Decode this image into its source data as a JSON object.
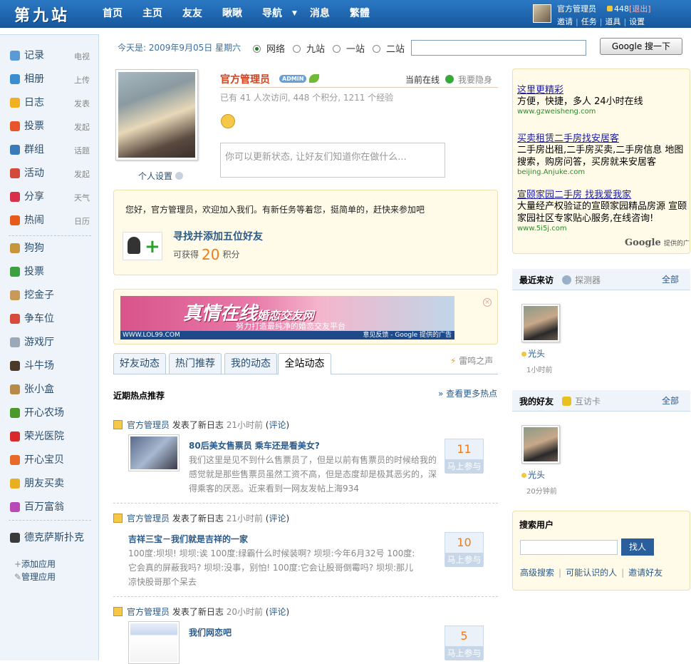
{
  "header": {
    "logo": "第九站",
    "nav": [
      "首页",
      "主页",
      "友友",
      "瞅瞅",
      "导航",
      "消息",
      "繁體"
    ],
    "user_name": "官方管理员",
    "coins": "448",
    "logout": "[退出]",
    "links": [
      "邀请",
      "任务",
      "道具",
      "设置"
    ]
  },
  "sidebar": {
    "primary": [
      {
        "label": "记录",
        "sub": "电视",
        "icon": "chat-icon",
        "color": "#5b9bd5"
      },
      {
        "label": "相册",
        "sub": "上传",
        "icon": "photo-icon",
        "color": "#3a8ed0"
      },
      {
        "label": "日志",
        "sub": "发表",
        "icon": "blog-icon",
        "color": "#f0b020"
      },
      {
        "label": "投票",
        "sub": "发起",
        "icon": "poll-icon",
        "color": "#e8552a"
      },
      {
        "label": "群组",
        "sub": "话题",
        "icon": "group-icon",
        "color": "#3a7ab8"
      },
      {
        "label": "活动",
        "sub": "发起",
        "icon": "calendar-icon",
        "color": "#d24a3a"
      },
      {
        "label": "分享",
        "sub": "天气",
        "icon": "heart-icon",
        "color": "#d8304a"
      },
      {
        "label": "热闹",
        "sub": "日历",
        "icon": "fire-icon",
        "color": "#e85a1a"
      }
    ],
    "apps": [
      {
        "label": "狗狗",
        "icon": "dog-icon",
        "color": "#c8963a"
      },
      {
        "label": "投票",
        "icon": "poll-icon",
        "color": "#3aa040"
      },
      {
        "label": "挖金子",
        "icon": "mine-icon",
        "color": "#c89a5a"
      },
      {
        "label": "争车位",
        "icon": "parking-icon",
        "color": "#d84a3a"
      },
      {
        "label": "游戏厅",
        "icon": "gamepad-icon",
        "color": "#9aa8b8"
      },
      {
        "label": "斗牛场",
        "icon": "bull-icon",
        "color": "#4a3a2a"
      },
      {
        "label": "张小盒",
        "icon": "box-icon",
        "color": "#b88a4a"
      },
      {
        "label": "开心农场",
        "icon": "sprout-icon",
        "color": "#4a9a2a"
      },
      {
        "label": "荣光医院",
        "icon": "hospital-icon",
        "color": "#d82a2a"
      },
      {
        "label": "开心宝贝",
        "icon": "baby-icon",
        "color": "#e86a2a"
      },
      {
        "label": "朋友买卖",
        "icon": "coins-icon",
        "color": "#e8b020"
      },
      {
        "label": "百万富翁",
        "icon": "star-icon",
        "color": "#b84ab8"
      },
      {
        "label": "德克萨斯扑克",
        "icon": "poker-icon",
        "color": "#3a3a3a"
      }
    ],
    "add_app": "添加应用",
    "manage_app": "管理应用"
  },
  "topbar": {
    "date": "今天是: 2009年9月05日 星期六",
    "radios": [
      "网络",
      "九站",
      "一站",
      "二站"
    ],
    "search_button": "Google 搜一下"
  },
  "profile": {
    "name": "官方管理员",
    "badge": "ADMIN",
    "online": "当前在线",
    "hide": "我要隐身",
    "stats": "已有 41 人次访问, 448 个积分, 1211 个经验",
    "status_placeholder": "你可以更新状态, 让好友们知道你在做什么...",
    "settings": "个人设置"
  },
  "welcome": {
    "text": "您好，官方管理员，欢迎加入我们。有新任务等着您，挺简单的，赶快来参加吧",
    "task_title": "寻找并添加五位好友",
    "reward_prefix": "可获得",
    "reward_value": "20",
    "reward_unit": "积分"
  },
  "banner": {
    "title": "真情在线",
    "title_small": "婚恋交友网",
    "subtitle": "努力打造最纯净的婚恋交友平台",
    "url": "WWW.LOL99.COM",
    "footer": "意见反馈 - Google 提供的广告"
  },
  "tabs": [
    "好友动态",
    "热门推荐",
    "我的动态",
    "全站动态"
  ],
  "thunder": "雷鸣之声",
  "hot": {
    "title": "近期热点推荐",
    "more": "» 查看更多热点"
  },
  "feeds": [
    {
      "user": "官方管理员",
      "action": "发表了新日志",
      "time": "21小时前",
      "comment": "评论",
      "title": "80后美女售票员  乘车还是看美女?",
      "lines": [
        "我们这里是见不到什么售票员了，但是以前有售票员的时候给我的",
        "感觉就是那些售票员虽然工资不高，但是态度却是极其恶劣的，深",
        "得乘客的厌恶。近来看到一网友发帖上海934"
      ],
      "count": "11",
      "join": "马上参与"
    },
    {
      "user": "官方管理员",
      "action": "发表了新日志",
      "time": "21小时前",
      "comment": "评论",
      "title": "吉祥三宝－我们就是吉祥的一家",
      "lines": [
        "100度:坝坝!  坝坝:诶 100度:绿霸什么时候装啊?  坝坝:今年6月32号 100度:",
        "它会真的屏蔽我吗?  坝坝:没事，别怕!  100度:它会让股哥倒霉吗?  坝坝:那儿",
        "凉快股哥那个呆去"
      ],
      "count": "10",
      "join": "马上参与"
    },
    {
      "user": "官方管理员",
      "action": "发表了新日志",
      "time": "20小时前",
      "comment": "评论",
      "title": "我们网恋吧",
      "lines": [],
      "count": "5",
      "join": "马上参与"
    }
  ],
  "ads": [
    {
      "title": "这里更精彩",
      "desc": "方便，快捷，多人 24小时在线",
      "url": "www.gzweisheng.com"
    },
    {
      "title": "买卖租赁二手房找安居客",
      "desc": "二手房出租,二手房买卖,二手房信息 地图搜索，购房问答，买房就来安居客",
      "url": "beijing.Anjuke.com"
    },
    {
      "title": "宣颐家园二手房 找我爱我家",
      "desc": "大量经产权验证的宣颐家园精品房源 宣颐家园社区专家贴心服务,在线咨询!",
      "url": "www.5i5j.com"
    }
  ],
  "google_provided": "Google",
  "google_provided_text": "提供的广",
  "visitors": {
    "title": "最近来访",
    "sub": "探测器",
    "all": "全部",
    "name": "光头",
    "time": "1小时前"
  },
  "friends": {
    "title": "我的好友",
    "sub": "互访卡",
    "all": "全部",
    "name": "光头",
    "time": "20分钟前"
  },
  "search_user": {
    "title": "搜索用户",
    "button": "找人",
    "links": [
      "高级搜索",
      "可能认识的人",
      "邀请好友"
    ]
  }
}
